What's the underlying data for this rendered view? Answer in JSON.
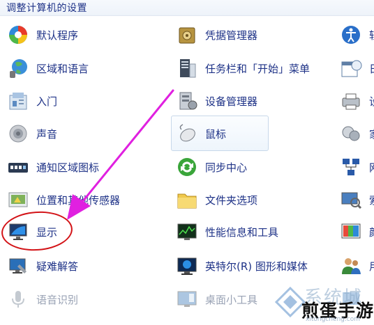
{
  "header": {
    "title": "调整计算机的设置"
  },
  "column1": [
    {
      "label": "默认程序",
      "icon": "default-programs-icon"
    },
    {
      "label": "区域和语言",
      "icon": "region-language-icon"
    },
    {
      "label": "入门",
      "icon": "getting-started-icon"
    },
    {
      "label": "声音",
      "icon": "sound-icon"
    },
    {
      "label": "通知区域图标",
      "icon": "notification-area-icon"
    },
    {
      "label": "位置和其他传感器",
      "icon": "location-sensors-icon"
    },
    {
      "label": "显示",
      "icon": "display-icon"
    },
    {
      "label": "疑难解答",
      "icon": "troubleshooting-icon"
    },
    {
      "label": "语音识别",
      "icon": "speech-recognition-icon"
    }
  ],
  "column2": [
    {
      "label": "凭据管理器",
      "icon": "credential-manager-icon"
    },
    {
      "label": "任务栏和「开始」菜单",
      "icon": "taskbar-start-menu-icon"
    },
    {
      "label": "设备管理器",
      "icon": "device-manager-icon"
    },
    {
      "label": "鼠标",
      "icon": "mouse-icon"
    },
    {
      "label": "同步中心",
      "icon": "sync-center-icon"
    },
    {
      "label": "文件夹选项",
      "icon": "folder-options-icon"
    },
    {
      "label": "性能信息和工具",
      "icon": "performance-icon"
    },
    {
      "label": "英特尔(R) 图形和媒体",
      "icon": "intel-graphics-icon"
    },
    {
      "label": "桌面小工具",
      "icon": "desktop-gadgets-icon"
    }
  ],
  "column3": [
    {
      "label": "轻",
      "icon": "ease-of-access-icon"
    },
    {
      "label": "日",
      "icon": "date-time-icon"
    },
    {
      "label": "设",
      "icon": "devices-printers-icon"
    },
    {
      "label": "家",
      "icon": "homegroup-icon"
    },
    {
      "label": "网",
      "icon": "network-center-icon"
    },
    {
      "label": "索",
      "icon": "indexing-icon"
    },
    {
      "label": "颜",
      "icon": "color-management-icon"
    },
    {
      "label": "用",
      "icon": "user-accounts-icon"
    },
    {
      "label": "",
      "icon": "windows-update-icon"
    }
  ],
  "annotations": {
    "arrow_color": "#e020e0",
    "circle_color": "#d31317"
  },
  "watermark": {
    "title": "系统城",
    "main": "煎蛋手游",
    "sub": "xitongcheng.com"
  }
}
